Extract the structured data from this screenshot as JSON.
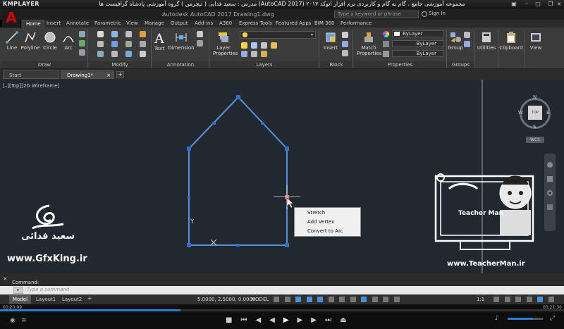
{
  "player": {
    "name": "KMPLAYER",
    "title": "مجموعه آموزشی جامع ، گام به گام و کاربردی نرم افزار اتوکد ۲۰۱۷ (AutoCAD 2017) مدرس : سعید فدایی ( تیچرمن ) گروه آموزشی پادشاه گرافیست ها",
    "time_current": "00:20:09",
    "time_total": "00:21:36",
    "progress_fraction": 0.32
  },
  "acad": {
    "title": "Autodesk AutoCAD 2017   Drawing1.dwg",
    "search_placeholder": "Type a keyword or phrase",
    "signin": "Sign In"
  },
  "ribbon_tabs": [
    "Home",
    "Insert",
    "Annotate",
    "Parametric",
    "View",
    "Manage",
    "Output",
    "Add-ins",
    "A360",
    "Express Tools",
    "Featured Apps",
    "BIM 360",
    "Performance"
  ],
  "draw_tools": [
    "Line",
    "Polyline",
    "Circle",
    "Arc"
  ],
  "annotation_tools": [
    "Text",
    "Dimension"
  ],
  "layer_tool": "Layer Properties",
  "insert_tool": "Insert",
  "match_tool": "Match Properties",
  "bylayer": [
    "ByLayer",
    "ByLayer",
    "ByLayer"
  ],
  "group_tool": "Group",
  "utilities_tool": "Utilities",
  "clipboard_tool": "Clipboard",
  "view_tool": "View",
  "panels": [
    "Draw",
    "Modify",
    "Annotation",
    "Layers",
    "Block",
    "Properties",
    "Groups"
  ],
  "file_tabs": [
    "Start",
    "Drawing1*"
  ],
  "view_label": "[–][Top][2D Wireframe]",
  "viewcube": {
    "n": "N",
    "s": "S",
    "e": "E",
    "w": "W",
    "top": "TOP",
    "wcs": "WCS"
  },
  "context_menu": [
    "Stretch",
    "Add Vertex",
    "Convert to Arc"
  ],
  "command": {
    "history_label": "Command:",
    "placeholder": "Type a command"
  },
  "layout_tabs": [
    "Model",
    "Layout1",
    "Layout2"
  ],
  "coords": "5.0000, 2.5000, 0.0000",
  "model_btn": "MODEL",
  "scale": "1:1",
  "brand": {
    "gfx_url": "www.GfxKing.ir",
    "fadaei": "سعید فدائی",
    "teacherman_url": "www.TeacherMan.ir",
    "teacherman_caption": "Teacher Man"
  },
  "colors": {
    "accent": "#2a7fd4",
    "autocad_red": "#c00000",
    "polyline": "#5a8fd8"
  }
}
